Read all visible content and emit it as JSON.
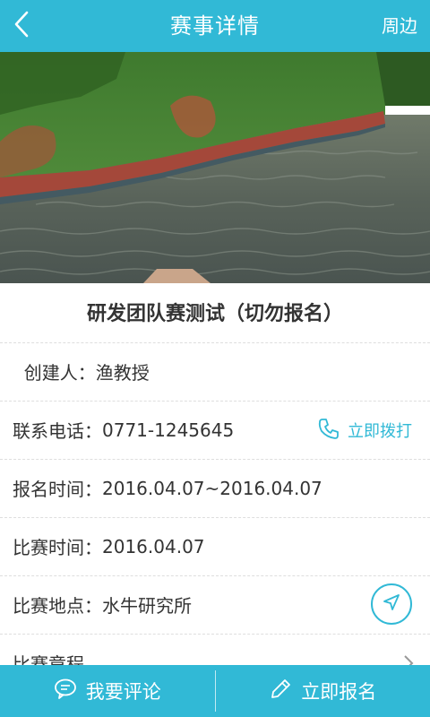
{
  "header": {
    "back_icon": "chevron-left-icon",
    "title": "赛事详情",
    "right_label": "周边"
  },
  "hero": {
    "description": "photo"
  },
  "event": {
    "title": "研发团队赛测试（切勿报名）"
  },
  "details": {
    "creator_label": "  创建人：",
    "creator_value": "渔教授",
    "phone_label": "联系电话：",
    "phone_value": "0771-1245645",
    "call_label": "立即拨打",
    "signup_time_label": "报名时间：",
    "signup_time_value": "2016.04.07~2016.04.07",
    "match_time_label": "比赛时间：",
    "match_time_value": "2016.04.07",
    "location_label": "比赛地点：",
    "location_value": "水牛研究所",
    "schedule_label": "比赛章程"
  },
  "footer": {
    "comment_label": "我要评论",
    "signup_label": "立即报名"
  },
  "colors": {
    "accent": "#31b9d6",
    "divider": "#dedede"
  }
}
